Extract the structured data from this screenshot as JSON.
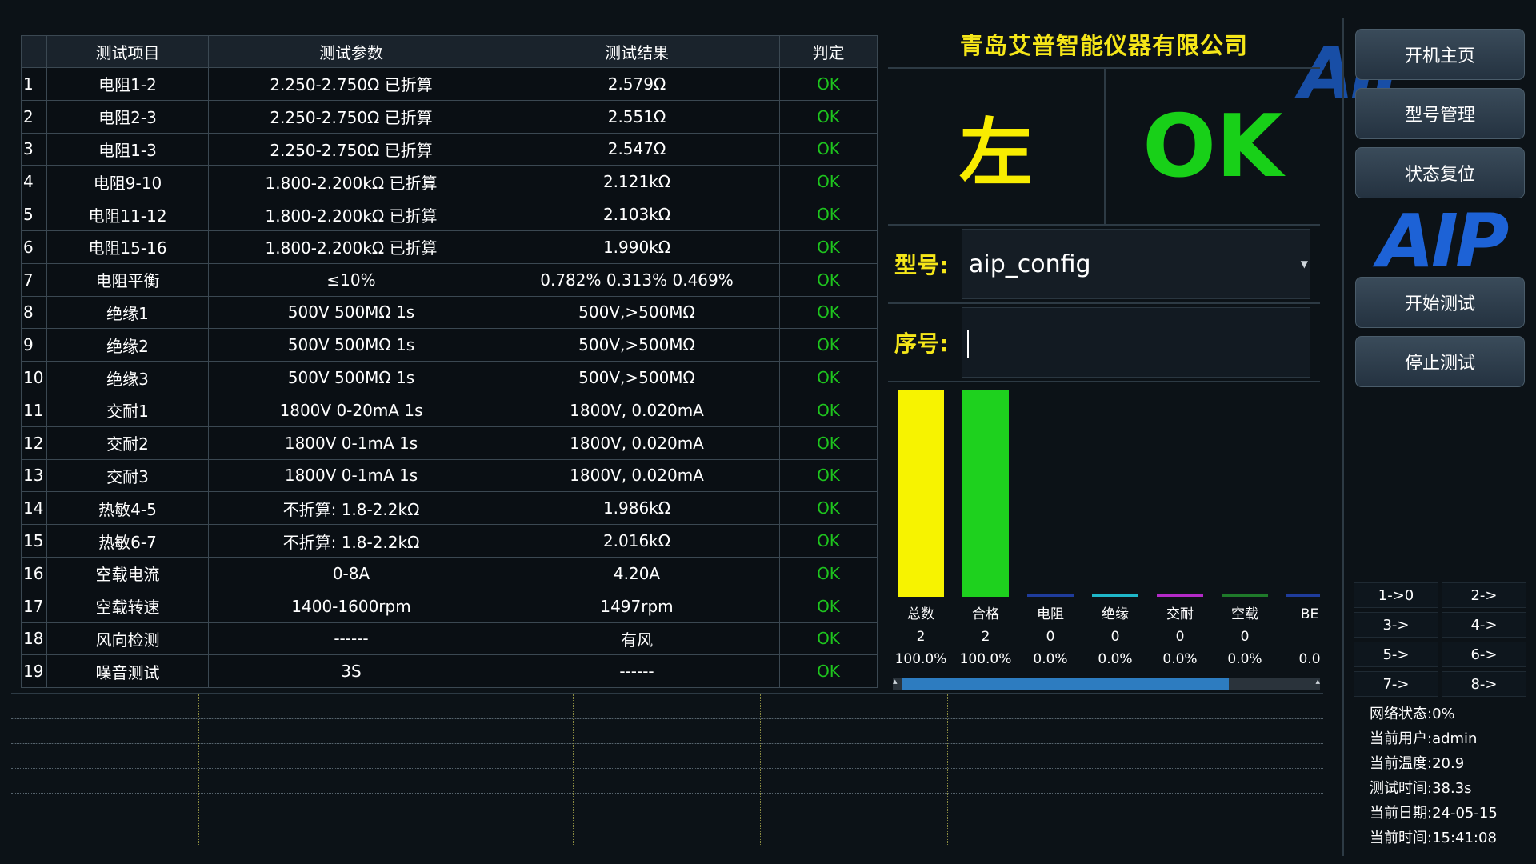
{
  "table": {
    "headers": [
      "",
      "测试项目",
      "测试参数",
      "测试结果",
      "判定"
    ],
    "rows": [
      {
        "idx": "1",
        "item": "电阻1-2",
        "param": "2.250-2.750Ω 已折算",
        "result": "2.579Ω",
        "verdict": "OK"
      },
      {
        "idx": "2",
        "item": "电阻2-3",
        "param": "2.250-2.750Ω 已折算",
        "result": "2.551Ω",
        "verdict": "OK"
      },
      {
        "idx": "3",
        "item": "电阻1-3",
        "param": "2.250-2.750Ω 已折算",
        "result": "2.547Ω",
        "verdict": "OK"
      },
      {
        "idx": "4",
        "item": "电阻9-10",
        "param": "1.800-2.200kΩ 已折算",
        "result": "2.121kΩ",
        "verdict": "OK"
      },
      {
        "idx": "5",
        "item": "电阻11-12",
        "param": "1.800-2.200kΩ 已折算",
        "result": "2.103kΩ",
        "verdict": "OK"
      },
      {
        "idx": "6",
        "item": "电阻15-16",
        "param": "1.800-2.200kΩ 已折算",
        "result": "1.990kΩ",
        "verdict": "OK"
      },
      {
        "idx": "7",
        "item": "电阻平衡",
        "param": "≤10%",
        "result": "0.782% 0.313% 0.469%",
        "verdict": "OK"
      },
      {
        "idx": "8",
        "item": "绝缘1",
        "param": "500V 500MΩ 1s",
        "result": "500V,>500MΩ",
        "verdict": "OK"
      },
      {
        "idx": "9",
        "item": "绝缘2",
        "param": "500V 500MΩ 1s",
        "result": "500V,>500MΩ",
        "verdict": "OK"
      },
      {
        "idx": "10",
        "item": "绝缘3",
        "param": "500V 500MΩ 1s",
        "result": "500V,>500MΩ",
        "verdict": "OK"
      },
      {
        "idx": "11",
        "item": "交耐1",
        "param": "1800V 0-20mA 1s",
        "result": "1800V, 0.020mA",
        "verdict": "OK"
      },
      {
        "idx": "12",
        "item": "交耐2",
        "param": "1800V 0-1mA 1s",
        "result": "1800V, 0.020mA",
        "verdict": "OK"
      },
      {
        "idx": "13",
        "item": "交耐3",
        "param": "1800V 0-1mA 1s",
        "result": "1800V, 0.020mA",
        "verdict": "OK"
      },
      {
        "idx": "14",
        "item": "热敏4-5",
        "param": "不折算: 1.8-2.2kΩ",
        "result": "1.986kΩ",
        "verdict": "OK"
      },
      {
        "idx": "15",
        "item": "热敏6-7",
        "param": "不折算: 1.8-2.2kΩ",
        "result": "2.016kΩ",
        "verdict": "OK"
      },
      {
        "idx": "16",
        "item": "空载电流",
        "param": "0-8A",
        "result": "4.20A",
        "verdict": "OK"
      },
      {
        "idx": "17",
        "item": "空载转速",
        "param": "1400-1600rpm",
        "result": "1497rpm",
        "verdict": "OK"
      },
      {
        "idx": "18",
        "item": "风向检测",
        "param": "------",
        "result": "有风",
        "verdict": "OK"
      },
      {
        "idx": "19",
        "item": "噪音测试",
        "param": "3S",
        "result": "------",
        "verdict": "OK"
      }
    ]
  },
  "header": {
    "company": "青岛艾普智能仪器有限公司",
    "side": "左",
    "overall_result": "OK"
  },
  "form": {
    "model_label": "型号:",
    "model_value": "aip_config",
    "serial_label": "序号:",
    "serial_value": ""
  },
  "chart_data": {
    "type": "bar",
    "categories": [
      "总数",
      "合格",
      "电阻",
      "绝缘",
      "交耐",
      "空载",
      "BE"
    ],
    "counts": [
      "2",
      "2",
      "0",
      "0",
      "0",
      "0",
      ""
    ],
    "percents": [
      "100.0%",
      "100.0%",
      "0.0%",
      "0.0%",
      "0.0%",
      "0.0%",
      "0.0"
    ],
    "values": [
      2,
      2,
      0,
      0,
      0,
      0,
      0
    ],
    "colors": [
      "#f7f300",
      "#1ed11e",
      "#1f3c9c",
      "#1fb7c9",
      "#b42ac8",
      "#1f7a2a",
      "#1f3c9c"
    ],
    "ylim": [
      0,
      2
    ]
  },
  "sidebar": {
    "buttons": [
      "开机主页",
      "型号管理",
      "状态复位",
      "开始测试",
      "停止测试"
    ],
    "logo": "AIP",
    "stations": [
      "1->0",
      "2->",
      "3->",
      "4->",
      "5->",
      "6->",
      "7->",
      "8->"
    ],
    "status": [
      "网络状态:0%",
      "当前用户:admin",
      "当前温度:20.9",
      "测试时间:38.3s",
      "当前日期:24-05-15",
      "当前时间:15:41:08"
    ]
  }
}
